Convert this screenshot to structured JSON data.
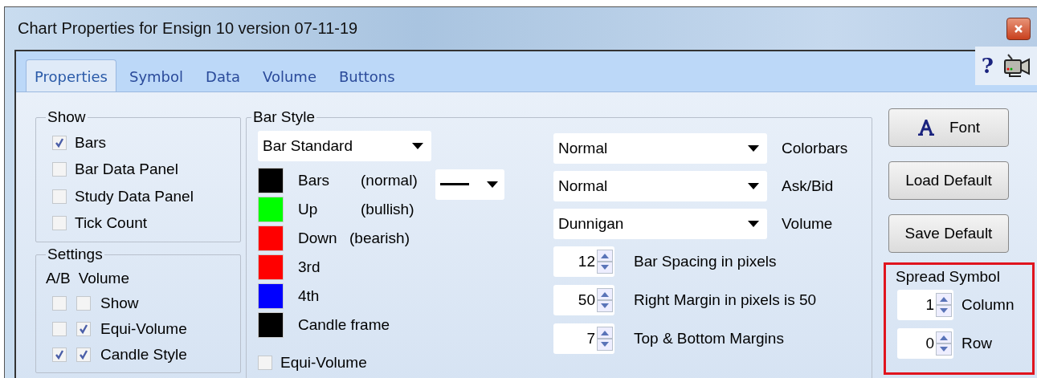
{
  "window": {
    "title": "Chart Properties for Ensign 10 version 07-11-19"
  },
  "tabs": [
    {
      "label": "Properties",
      "selected": true
    },
    {
      "label": "Symbol",
      "selected": false
    },
    {
      "label": "Data",
      "selected": false
    },
    {
      "label": "Volume",
      "selected": false
    },
    {
      "label": "Buttons",
      "selected": false
    }
  ],
  "help": {
    "label": "?"
  },
  "show_group": {
    "title": "Show",
    "items": [
      {
        "label": "Bars",
        "checked": true
      },
      {
        "label": "Bar Data Panel",
        "checked": false
      },
      {
        "label": "Study Data Panel",
        "checked": false
      },
      {
        "label": "Tick Count",
        "checked": false
      }
    ]
  },
  "settings_group": {
    "title": "Settings",
    "headers": [
      "A/B",
      "Volume"
    ],
    "rows": [
      {
        "label": "Show",
        "ab_checked": false,
        "volume_checked": false
      },
      {
        "label": "Equi-Volume",
        "ab_checked": false,
        "volume_checked": true
      },
      {
        "label": "Candle Style",
        "ab_checked": true,
        "volume_checked": true
      }
    ]
  },
  "bar_style": {
    "title": "Bar Style",
    "style_select": "Bar Standard",
    "colors": [
      {
        "label": "Bars",
        "note": "(normal)",
        "color": "#000000"
      },
      {
        "label": "Up",
        "note": "(bullish)",
        "color": "#00ff00"
      },
      {
        "label": "Down",
        "note": "(bearish)",
        "color": "#ff0000"
      },
      {
        "label": "3rd",
        "color": "#ff0000"
      },
      {
        "label": "4th",
        "color": "#0000ff"
      },
      {
        "label": "Candle frame",
        "color": "#000000"
      }
    ],
    "equi_volume": {
      "label": "Equi-Volume",
      "checked": false
    },
    "dropdowns": [
      {
        "value": "Normal",
        "label": "Colorbars"
      },
      {
        "value": "Normal",
        "label": "Ask/Bid"
      },
      {
        "value": "Dunnigan",
        "label": "Volume"
      }
    ],
    "spinners": [
      {
        "value": "12",
        "label": "Bar Spacing in pixels"
      },
      {
        "value": "50",
        "label": "Right Margin in pixels is 50"
      },
      {
        "value": "7",
        "label": "Top & Bottom Margins"
      }
    ]
  },
  "buttons": [
    {
      "label": "Font",
      "kind": "font"
    },
    {
      "label": "Load Default",
      "kind": "plain"
    },
    {
      "label": "Save Default",
      "kind": "plain"
    }
  ],
  "spread_symbol": {
    "title": "Spread Symbol",
    "spinners": [
      {
        "value": "1",
        "label": "Column"
      },
      {
        "value": "0",
        "label": "Row"
      }
    ]
  }
}
